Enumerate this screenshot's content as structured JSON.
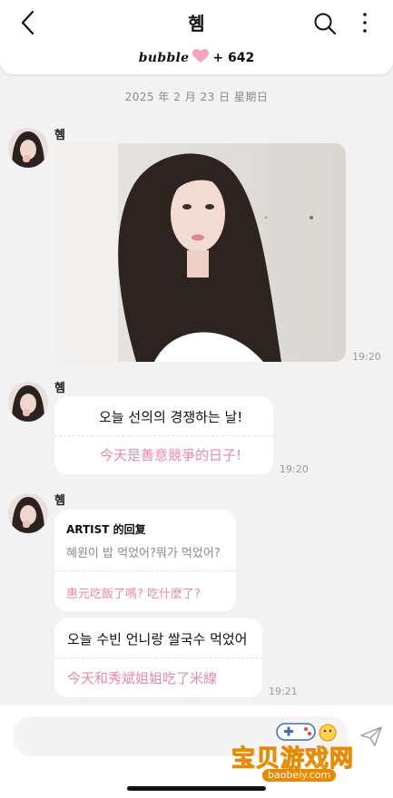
{
  "header": {
    "title": "혬",
    "bubble_brand": "bubble",
    "bubble_count": "+ 642",
    "back_icon": "chevron-left-icon",
    "search_icon": "search-icon",
    "more_icon": "more-vertical-icon"
  },
  "colors": {
    "translation_pink": "#e88aa8",
    "heart_pink": "#f5a3bf",
    "background": "#f2f2f2"
  },
  "date_separator": "2025 年 2 月 23 日 星期日",
  "messages": [
    {
      "sender": "혬",
      "type": "image",
      "time": "19:20"
    },
    {
      "sender": "혬",
      "type": "text",
      "text": "오늘 선의의 경쟁하는 날!",
      "translation": "今天是善意競爭的日子!",
      "time": "19:20"
    },
    {
      "sender": "혬",
      "type": "reply",
      "reply_header": "ARTIST 的回复",
      "reply_original": "혜원이 밥 먹었어?뭐가 먹었어?",
      "reply_translation": "惠元吃飯了嗎? 吃什麼了?"
    },
    {
      "sender": "혬",
      "type": "text",
      "text": "오늘 수빈 언니랑 쌀국수 먹었어",
      "translation": "今天和秀斌姐姐吃了米線",
      "time": "19:21"
    }
  ],
  "watermark": {
    "text": "宝贝游戏网",
    "url": "baobeiy.com"
  }
}
